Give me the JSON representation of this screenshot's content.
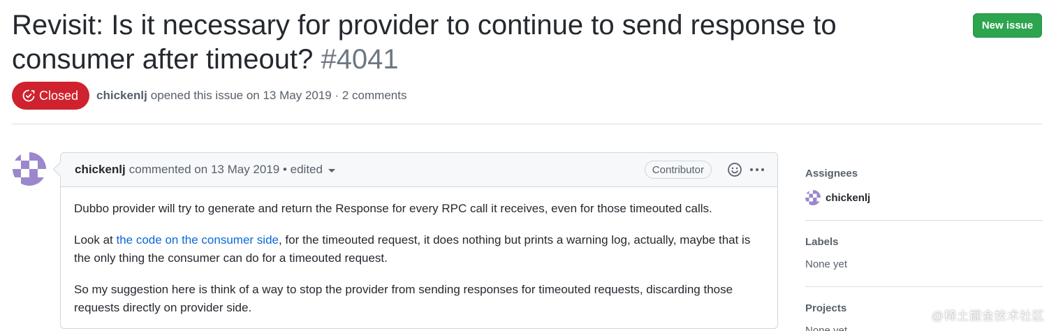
{
  "issue": {
    "title": "Revisit: Is it necessary for provider to continue to send response to consumer after timeout?",
    "number": "#4041",
    "state": "Closed",
    "author": "chickenlj",
    "meta_text": "opened this issue on 13 May 2019 · 2 comments"
  },
  "header": {
    "new_issue_label": "New issue"
  },
  "comment": {
    "author": "chickenlj",
    "meta": "commented on 13 May 2019 • edited",
    "badge": "Contributor",
    "paragraph1": "Dubbo provider will try to generate and return the Response for every RPC call it receives, even for those timeouted calls.",
    "p2_before": "Look at ",
    "p2_link": "the code on the consumer side",
    "p2_after": ", for the timeouted request, it does nothing but prints a warning log, actually, maybe that is the only thing the consumer can do for a timeouted request.",
    "paragraph3": "So my suggestion here is think of a way to stop the provider from sending responses for timeouted requests, discarding those requests directly on provider side."
  },
  "sidebar": {
    "assignees_label": "Assignees",
    "assignee": "chickenlj",
    "labels_label": "Labels",
    "labels_value": "None yet",
    "projects_label": "Projects",
    "projects_value": "None yet"
  },
  "watermark": "@稀土掘金技术社区",
  "colors": {
    "closed": "#cf222e",
    "new_issue": "#2da44e",
    "link": "#0969da",
    "avatar_purple": "#9b88cc"
  },
  "icons": [
    "issue-closed-icon",
    "caret-down-icon",
    "smiley-icon",
    "kebab-horizontal-icon"
  ]
}
